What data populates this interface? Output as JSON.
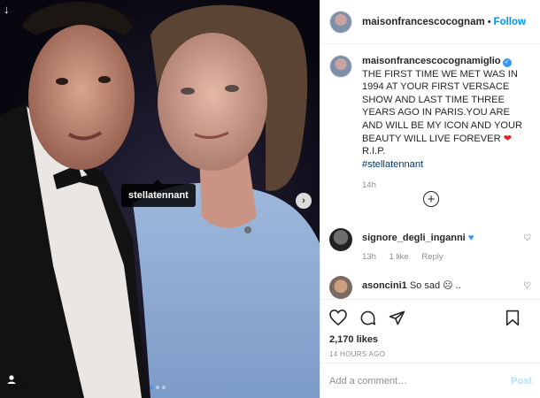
{
  "post": {
    "tagged_user": "stellatennant",
    "carousel_count": 3,
    "carousel_active": 0
  },
  "header": {
    "username": "maisonfrancescocognam",
    "separator": "•",
    "follow_label": "Follow",
    "more_label": "•••"
  },
  "caption": {
    "username": "maisonfrancescocognamiglio",
    "text": "THE FIRST TIME WE MET WAS IN 1994 AT YOUR FIRST VERSACE SHOW AND LAST TIME THREE YEARS AGO IN PARIS.YOU ARE AND WILL BE MY ICON AND YOUR BEAUTY WILL LIVE FOREVER",
    "text_after": "R.I.P.",
    "hashtag": "#stellatennant",
    "time": "14h"
  },
  "comments": [
    {
      "username": "signore_degli_inganni",
      "text": "",
      "emoji": "blue-heart",
      "time": "13h",
      "likes": "1 like",
      "reply": "Reply"
    },
    {
      "username": "asoncini1",
      "text": "So sad",
      "emoji": "sad-face",
      "time": "",
      "likes": "",
      "reply": ""
    }
  ],
  "stats": {
    "likes": "2,170 likes",
    "posted": "14 HOURS AGO"
  },
  "add_comment": {
    "placeholder": "Add a comment…",
    "post_label": "Post"
  },
  "colors": {
    "accent": "#0095f6",
    "verified": "#3897f0",
    "heart": "#ed1b24",
    "photo_bg": "#0d0c16"
  }
}
